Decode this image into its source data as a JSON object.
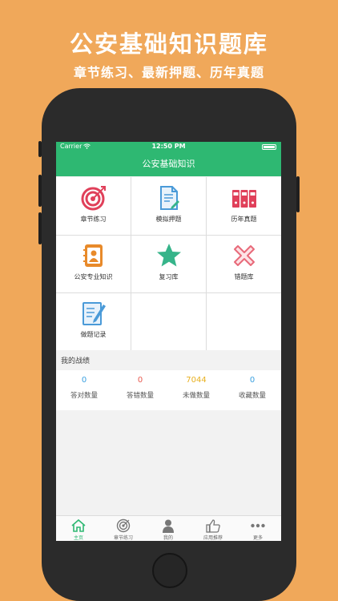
{
  "banner": {
    "headline": "公安基础知识题库",
    "subline": "章节练习、最新押题、历年真题"
  },
  "status_bar": {
    "carrier": "Carrier",
    "time": "12:50 PM"
  },
  "navbar": {
    "title": "公安基础知识"
  },
  "menu": [
    {
      "label": "章节练习",
      "icon": "target-icon"
    },
    {
      "label": "模拟押题",
      "icon": "document-icon"
    },
    {
      "label": "历年真题",
      "icon": "binders-icon"
    },
    {
      "label": "公安专业知识",
      "icon": "contact-book-icon"
    },
    {
      "label": "复习库",
      "icon": "star-icon"
    },
    {
      "label": "错题库",
      "icon": "cross-icon"
    },
    {
      "label": "做题记录",
      "icon": "notes-pen-icon"
    }
  ],
  "stats": {
    "title": "我的战绩",
    "items": [
      {
        "value": "0",
        "label": "答对数量",
        "color": "#3aa0e0"
      },
      {
        "value": "0",
        "label": "答错数量",
        "color": "#e85a4f"
      },
      {
        "value": "7044",
        "label": "未做数量",
        "color": "#e8b020"
      },
      {
        "value": "0",
        "label": "收藏数量",
        "color": "#3aa0e0"
      }
    ]
  },
  "tabbar": [
    {
      "label": "主页",
      "icon": "home-icon",
      "active": true
    },
    {
      "label": "章节练习",
      "icon": "target-icon"
    },
    {
      "label": "我的",
      "icon": "person-icon"
    },
    {
      "label": "应用推荐",
      "icon": "thumbs-up-icon"
    },
    {
      "label": "更多",
      "icon": "more-dots-icon"
    }
  ],
  "colors": {
    "background": "#f0a85a",
    "accent": "#2eb872",
    "icon_red": "#e0405a",
    "icon_blue": "#4a9ad8",
    "icon_orange": "#e88a2a",
    "icon_green": "#36b48a",
    "icon_pink": "#e86a7a"
  }
}
